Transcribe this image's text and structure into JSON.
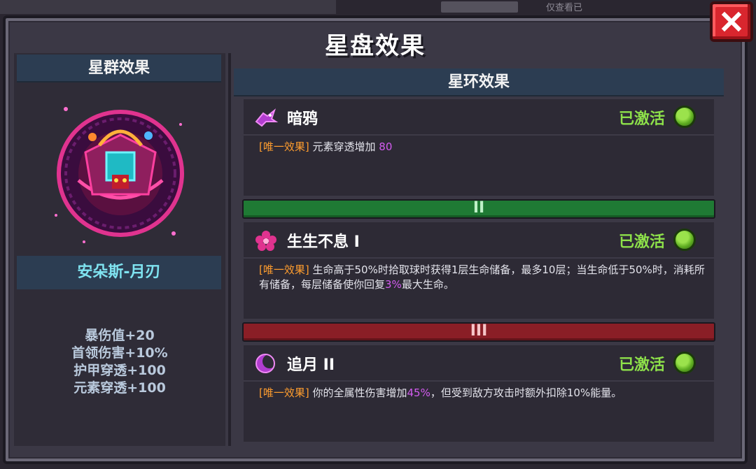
{
  "background": {
    "top_text": "仅查看已"
  },
  "panel": {
    "title": "星盘效果"
  },
  "left": {
    "header": "星群效果",
    "hero_name": "安朵斯-月刃",
    "stats": [
      "暴伤值+20",
      "首领伤害+10%",
      "护甲穿透+100",
      "元素穿透+100"
    ]
  },
  "right": {
    "header": "星环效果",
    "rings": [
      {
        "icon": "crow-icon",
        "name": "暗鸦",
        "status": "已激活",
        "tag": "[唯一效果]",
        "desc_parts": [
          "元素穿透增加 ",
          "80",
          ""
        ]
      },
      {
        "icon": "flower-icon",
        "name": "生生不息 I",
        "status": "已激活",
        "tag": "[唯一效果]",
        "desc_parts": [
          "生命高于50%时拾取球时获得1层生命储备，最多10层；当生命低于50%时，消耗所有储备，每层储备使你回复",
          "3%",
          "最大生命。"
        ]
      },
      {
        "icon": "crescent-moon-icon",
        "name": "追月 II",
        "status": "已激活",
        "tag": "[唯一效果]",
        "desc_parts": [
          "你的全属性伤害增加",
          "45%",
          "，但受到敌方攻击时额外扣除10%能量。"
        ]
      }
    ],
    "tiers": [
      "II",
      "III"
    ]
  },
  "colors": {
    "status_active": "#8de04a",
    "tag": "#ff9d2e",
    "highlight": "#d35cf0",
    "tier_2": "#1f7a34",
    "tier_3": "#8a1e26",
    "close": "#d9262e"
  }
}
